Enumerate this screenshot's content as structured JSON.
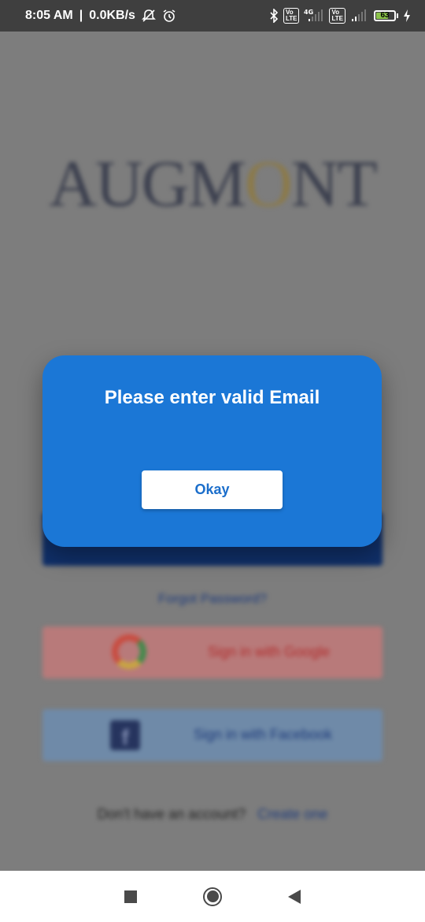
{
  "status_bar": {
    "time": "8:05 AM",
    "network_speed": "0.0KB/s",
    "icons": [
      "mute-notifications-icon",
      "alarm-icon",
      "bluetooth-icon",
      "volte-icon",
      "signal-4g-icon",
      "signal-icon"
    ],
    "volte_label_1": "Vo\nLTE",
    "network_type": "4G",
    "battery_level": "63"
  },
  "background": {
    "logo_text": "AUGMONT",
    "forgot_password": "Forgot Password?",
    "google_button": "Sign in with Google",
    "facebook_button": "Sign in with Facebook",
    "signup_prompt": "Don't have an account?",
    "signup_link": "Create one"
  },
  "dialog": {
    "message": "Please enter valid Email",
    "button_label": "Okay"
  },
  "colors": {
    "dialog_bg": "#1b77d6",
    "button_text": "#1b6ecb",
    "overlay": "#7d7d7d"
  },
  "nav_bar": {
    "icons": [
      "recent-apps-icon",
      "home-icon",
      "back-icon"
    ]
  }
}
